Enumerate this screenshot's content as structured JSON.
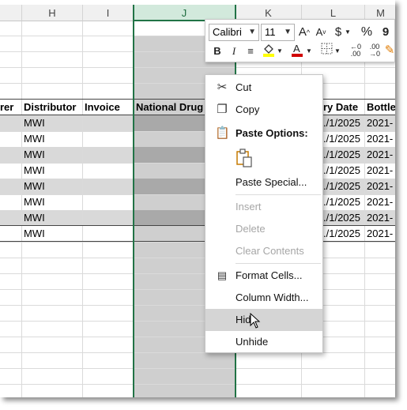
{
  "columns": [
    "H",
    "I",
    "J",
    "K",
    "L",
    "M"
  ],
  "headers": {
    "g_partial": "rer",
    "h": "Distributor",
    "i": "Invoice",
    "j": "National Drug",
    "l_partial": "ry Date",
    "m_partial": "Bottle"
  },
  "rows": [
    {
      "distributor": "MWI",
      "date": "./1/2025",
      "bottle": "2021-"
    },
    {
      "distributor": "MWI",
      "date": "./1/2025",
      "bottle": "2021-"
    },
    {
      "distributor": "MWI",
      "date": "./1/2025",
      "bottle": "2021-"
    },
    {
      "distributor": "MWI",
      "date": "./1/2025",
      "bottle": "2021-"
    },
    {
      "distributor": "MWI",
      "date": "./1/2025",
      "bottle": "2021-"
    },
    {
      "distributor": "MWI",
      "date": "./1/2025",
      "bottle": "2021-"
    },
    {
      "distributor": "MWI",
      "date": "./1/2025",
      "bottle": "2021-"
    },
    {
      "distributor": "MWI",
      "date": "./1/2025",
      "bottle": "2021-"
    }
  ],
  "mini_toolbar": {
    "font": "Calibri",
    "size": "11",
    "grow": "A",
    "shrink": "A",
    "currency": "$",
    "percent": "%",
    "comma": "9",
    "bold": "B",
    "italic": "I"
  },
  "menu": {
    "cut": "Cut",
    "copy": "Copy",
    "paste_options": "Paste Options:",
    "paste_special": "Paste Special...",
    "insert": "Insert",
    "delete": "Delete",
    "clear_contents": "Clear Contents",
    "format_cells": "Format Cells...",
    "column_width": "Column Width...",
    "hide": "Hide",
    "unhide": "Unhide"
  },
  "colors": {
    "accent": "#217346",
    "band": "#d9d9d9",
    "selected_col": "#cfcfcf"
  }
}
